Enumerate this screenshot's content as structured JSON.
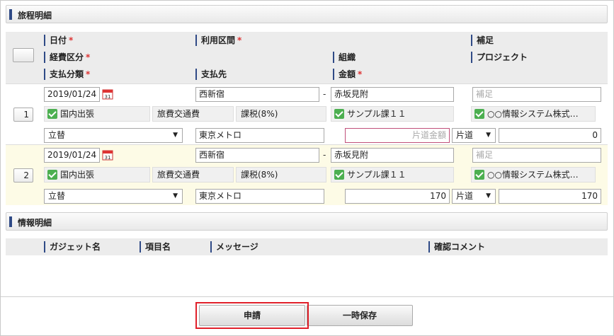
{
  "section_travel": {
    "title": "旅程明細"
  },
  "section_info": {
    "title": "情報明細"
  },
  "header": {
    "row1": {
      "date": "日付",
      "route": "利用区間",
      "note": "補足"
    },
    "row2": {
      "expense_type": "経費区分",
      "org": "組織",
      "project": "プロジェクト"
    },
    "row3": {
      "payment_type": "支払分類",
      "payee": "支払先",
      "amount": "金額"
    },
    "required_mark": "*"
  },
  "items": [
    {
      "no": "1",
      "date": "2019/01/24",
      "from": "西新宿",
      "to": "赤坂見附",
      "route_sep": "-",
      "note_placeholder": "補足",
      "expense_category": "国内出張",
      "expense_item": "旅費交通費",
      "tax": "課税(8%)",
      "org": "サンプル課１１",
      "project": "○○情報システム株式…",
      "payment": "立替",
      "payee": "東京メトロ",
      "amount_placeholder": "片道金額",
      "trip": "片道",
      "total": "0"
    },
    {
      "no": "2",
      "date": "2019/01/24",
      "from": "西新宿",
      "to": "赤坂見附",
      "route_sep": "-",
      "note_placeholder": "補足",
      "expense_category": "国内出張",
      "expense_item": "旅費交通費",
      "tax": "課税(8%)",
      "org": "サンプル課１１",
      "project": "○○情報システム株式…",
      "payment": "立替",
      "payee": "東京メトロ",
      "amount": "170",
      "trip": "片道",
      "total": "170"
    }
  ],
  "info_header": {
    "gadget": "ガジェット名",
    "item": "項目名",
    "message": "メッセージ",
    "comment": "確認コメント"
  },
  "buttons": {
    "apply": "申請",
    "save": "一時保存"
  },
  "icons": {
    "calendar": "calendar-icon",
    "dropdown": "chevron-down-icon",
    "check": "check-icon"
  },
  "colors": {
    "accent": "#2f4a86",
    "required": "#dd3333",
    "highlight": "#e0202a",
    "check": "#4caf50"
  }
}
